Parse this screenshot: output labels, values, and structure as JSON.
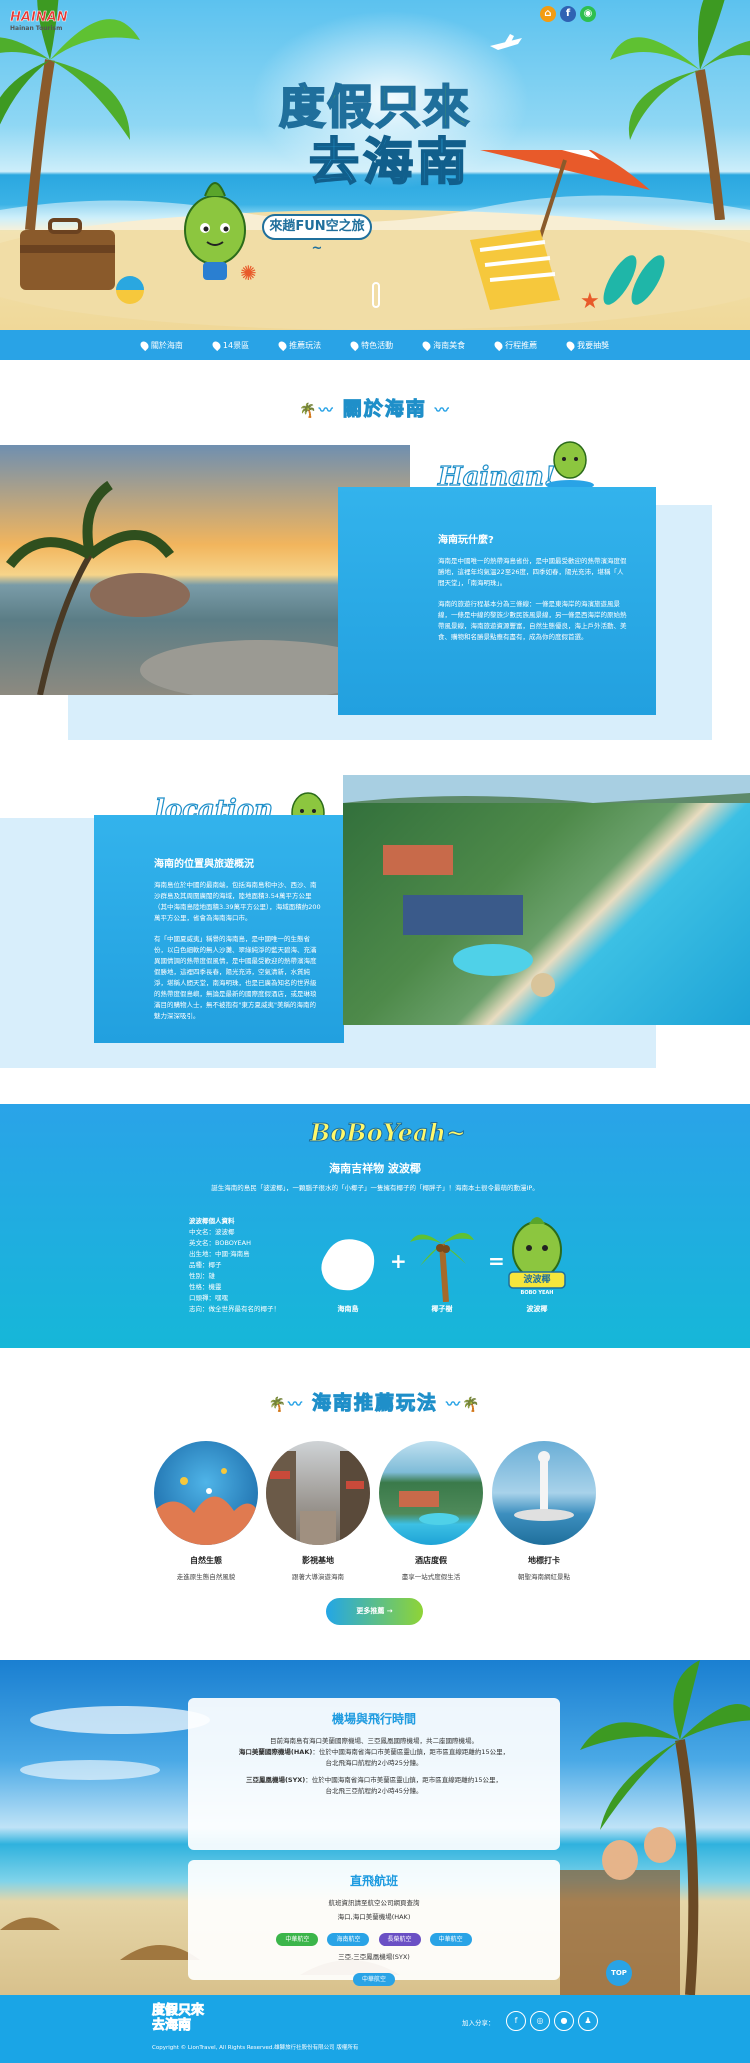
{
  "header": {
    "logo_text": "HAINAN",
    "logo_sub": "Hainan Tourism",
    "title_line1": "度假只來",
    "title_line2": "去海南",
    "tagline": "來趟FUN空之旅~",
    "social": [
      "home-icon",
      "facebook-icon",
      "line-icon"
    ]
  },
  "nav": {
    "items": [
      "關於海南",
      "14景區",
      "推薦玩法",
      "特色活動",
      "海南美食",
      "行程推薦",
      "我要抽獎"
    ]
  },
  "about": {
    "heading": "關於海南",
    "hainan_script": "Hainan!",
    "card1_title": "海南玩什麼?",
    "card1_p1": "海南是中國唯一的熱帶海島省份，是中國最受歡迎的熱帶濱海度假勝地，這裡年均氣溫22至26度，四季如春，陽光充沛，堪稱「人間天堂」，「南海明珠」。",
    "card1_p2": "海南的旅遊行程基本分為三條線：一條是東海岸的海濱旅遊風景線，一條是中線的黎族少數民族風景線，另一條是西海岸的原始熱帶風景線，海南旅遊資源豐富，自然生態優良，海上戶外活動、美食、購物和名勝景點應有盡有，成為你的度假首選。",
    "location_script": "location",
    "card2_title": "海南的位置與旅遊概況",
    "card2_p1": "海南島位於中國的最南端，包括海南島和中沙、西沙、南沙群島及其周圍廣闊的海域，陸地面積3.54萬平方公里（其中海南島陸地面積3.39萬平方公里），海域面積約200萬平方公里，省會為海南海口市。",
    "card2_p2": "有「中國夏威夷」稱譽的海南島，是中國唯一的生態省份，以白色細軟的無人沙灘、翠綠純淨的藍天碧海、充滿異國情調的熱帶度假風情，是中國最受歡迎的熱帶濱海度假勝地，這裡四季長春，陽光充沛，空氣清新，水質純淨，堪稱人間天堂，南海明珠，也是已廣為知名的世界級的熱帶度假島嶼，無論是最新的國際度假酒店，或是琳琅滿目的購物人士，無不被抱有\"東方夏威夷\"美稱的海南的魅力深深吸引。"
  },
  "mascot": {
    "script": "BoBoYeah~",
    "title": "海南吉祥物 波波椰",
    "desc": "誕生海南的島民「波波椰」，一顆腦子很水的「小椰子」一隻擁有椰子的「椰胖子」！海南本土很令最萌的動漫IP。",
    "profile_title": "波波椰個人資料",
    "profile": [
      "中文名：波波椰",
      "英文名：BOBOYEAH",
      "出生地：中國·海南島",
      "品種：椰子",
      "性別：雄",
      "性格：機靈",
      "口頭禪：嘿嘿",
      "志向：做全世界最有名的椰子！"
    ],
    "eq_labels": [
      "海南島",
      "椰子樹",
      "波波椰"
    ],
    "badge_text": "波波椰",
    "badge_sub": "BOBO YEAH"
  },
  "play": {
    "heading": "海南推薦玩法",
    "items": [
      {
        "title": "自然生態",
        "desc": "走進原生態自然風貌"
      },
      {
        "title": "影視基地",
        "desc": "跟著大導演遊海南"
      },
      {
        "title": "酒店度假",
        "desc": "盡享一站式度假生活"
      },
      {
        "title": "地標打卡",
        "desc": "朝聖海南網紅景點"
      }
    ],
    "more_button": "更多推薦 →"
  },
  "airport": {
    "title": "機場與飛行時間",
    "intro": "目前海南島有海口美蘭國際機場、三亞鳳凰國際機場，共二座國際機場。",
    "hak_name": "海口美蘭國際機場(HAK)",
    "hak_text": "：位於中國海南省海口市美蘭區靈山鎮，距市區直線距離約15公里，",
    "hak_time": "台北飛海口航程約2小時25分鐘。",
    "syx_name": "三亞鳳凰機場(SYX)",
    "syx_text": "：位於中國海南省海口市美蘭區靈山鎮，距市區直線距離約15公里，",
    "syx_time": "台北飛三亞航程約2小時45分鐘。",
    "direct_title": "直飛航班",
    "direct_sub": "航班資訊請至航空公司網頁查詢",
    "hak_route": "海口,海口美蘭機場(HAK)",
    "hak_airlines": [
      "中華航空",
      "海南航空",
      "長榮航空",
      "中華航空"
    ],
    "syx_route": "三亞,三亞鳳凰機場(SYX)",
    "syx_airlines": [
      "中華航空"
    ]
  },
  "footer": {
    "logo_line1": "度假只來",
    "logo_line2": "去海南",
    "copyright": "Copyright © LionTravel, All Rights Reserved.雄獅旅行社股份有限公司 版權所有",
    "share_label": "加入分享：",
    "icons": [
      "facebook-icon",
      "weibo-icon",
      "wechat-icon",
      "qq-icon"
    ],
    "top_label": "TOP"
  },
  "colors": {
    "primary": "#29a3e6",
    "green": "#7ed321",
    "dark_blue": "#1f6f9c"
  }
}
